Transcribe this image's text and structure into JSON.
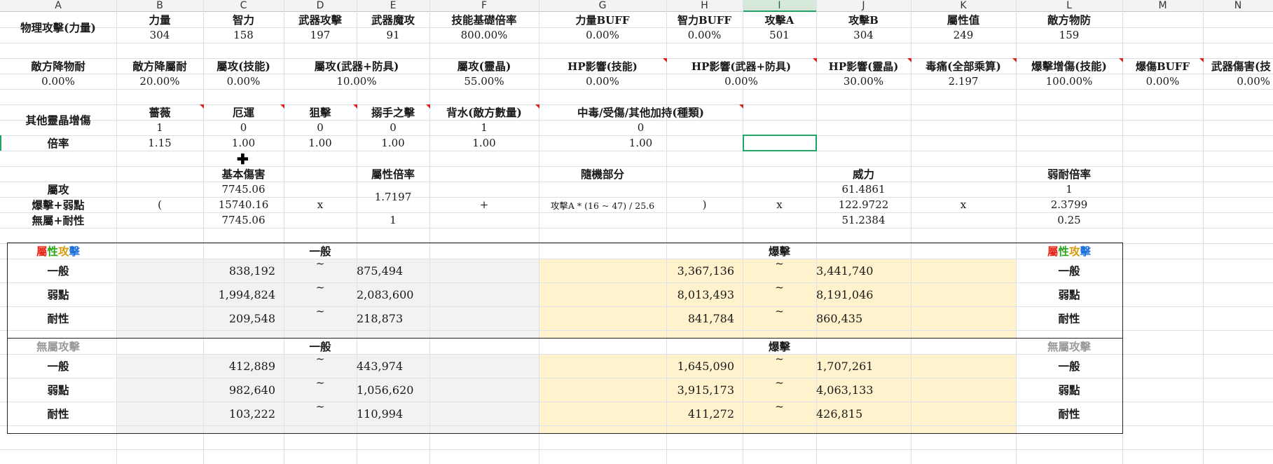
{
  "columns": [
    "A",
    "B",
    "C",
    "D",
    "E",
    "F",
    "G",
    "H",
    "I",
    "J",
    "K",
    "L",
    "M",
    "N"
  ],
  "selected_column": "I",
  "row1": {
    "A": "物理攻擊(力量)",
    "B": "力量",
    "C": "智力",
    "D": "武器攻擊",
    "E": "武器魔攻",
    "F": "技能基礎倍率",
    "G": "力量BUFF",
    "H": "智力BUFF",
    "I": "攻擊A",
    "J": "攻擊B",
    "K": "屬性值",
    "L": "敵方物防"
  },
  "row2": {
    "B": "304",
    "C": "158",
    "D": "197",
    "E": "91",
    "F": "800.00%",
    "G": "0.00%",
    "H": "0.00%",
    "I": "501",
    "J": "304",
    "K": "249",
    "L": "159"
  },
  "row4": {
    "A": "敵方降物耐",
    "B": "敵方降屬耐",
    "C": "屬攻(技能)",
    "DE": "屬攻(武器+防具)",
    "F": "屬攻(靈晶)",
    "G": "HP影響(技能)",
    "HI": "HP影響(武器+防具)",
    "J": "HP影響(靈晶)",
    "K": "毒痛(全部乘算)",
    "L": "爆擊增傷(技能)",
    "M": "爆傷BUFF",
    "N": "武器傷害(技"
  },
  "row5": {
    "A": "0.00%",
    "B": "20.00%",
    "C": "0.00%",
    "DE": "10.00%",
    "F": "55.00%",
    "G": "0.00%",
    "HI": "0.00%",
    "J": "30.00%",
    "K": "2.197",
    "L": "100.00%",
    "M": "0.00%",
    "N": "0.00%"
  },
  "row7": {
    "A": "其他靈晶增傷",
    "B": "薔薇",
    "C": "厄運",
    "D": "狙擊",
    "E": "搦手之擊",
    "F": "背水(敵方數量)",
    "GH": "中毒/受傷/其他加持(種類)"
  },
  "row8": {
    "B": "1",
    "C": "0",
    "D": "0",
    "E": "0",
    "F": "1",
    "GH": "0"
  },
  "row9": {
    "A": "倍率",
    "B": "1.15",
    "C": "1.00",
    "D": "1.00",
    "E": "1.00",
    "F": "1.00",
    "GH": "1.00"
  },
  "formula": {
    "labels": [
      "屬攻",
      "爆擊+弱點",
      "無屬+耐性"
    ],
    "open_paren": "(",
    "base_header": "基本傷害",
    "base": [
      "7745.06",
      "15740.16",
      "7745.06"
    ],
    "times1": "x",
    "attr_header": "屬性倍率",
    "attr": [
      "1.7197",
      "1"
    ],
    "plus": "+",
    "random_header": "隨機部分",
    "random_formula": "攻擊A * (16 ~ 47) / 25.6",
    "close_paren": ")",
    "times2": "x",
    "power_header": "威力",
    "power": [
      "61.4861",
      "122.9722",
      "51.2384"
    ],
    "times3": "x",
    "weak_header": "弱耐倍率",
    "weak": [
      "1",
      "2.3799",
      "0.25"
    ]
  },
  "results": {
    "attr_title": [
      "屬",
      "性",
      "攻",
      "擊"
    ],
    "normal_header": "一般",
    "crit_header": "爆擊",
    "tilde": "~",
    "row_labels": [
      "一般",
      "弱點",
      "耐性"
    ],
    "attr_rows": [
      {
        "nmin": "838,192",
        "nmax": "875,494",
        "cmin": "3,367,136",
        "cmax": "3,441,740"
      },
      {
        "nmin": "1,994,824",
        "nmax": "2,083,600",
        "cmin": "8,013,493",
        "cmax": "8,191,046"
      },
      {
        "nmin": "209,548",
        "nmax": "218,873",
        "cmin": "841,784",
        "cmax": "860,435"
      }
    ],
    "nonattr_title": "無屬攻擊",
    "nonattr_rows": [
      {
        "nmin": "412,889",
        "nmax": "443,974",
        "cmin": "1,645,090",
        "cmax": "1,707,261"
      },
      {
        "nmin": "982,640",
        "nmax": "1,056,620",
        "cmin": "3,915,173",
        "cmax": "4,063,133"
      },
      {
        "nmin": "103,222",
        "nmax": "110,994",
        "cmin": "411,272",
        "cmax": "426,815"
      }
    ]
  },
  "colors": {
    "grid": "#dde0ea",
    "selection": "#21a366",
    "yellow_fill": "#fff2cc",
    "gray_fill": "#f2f2f2",
    "comment_marker": "#e0201b"
  }
}
